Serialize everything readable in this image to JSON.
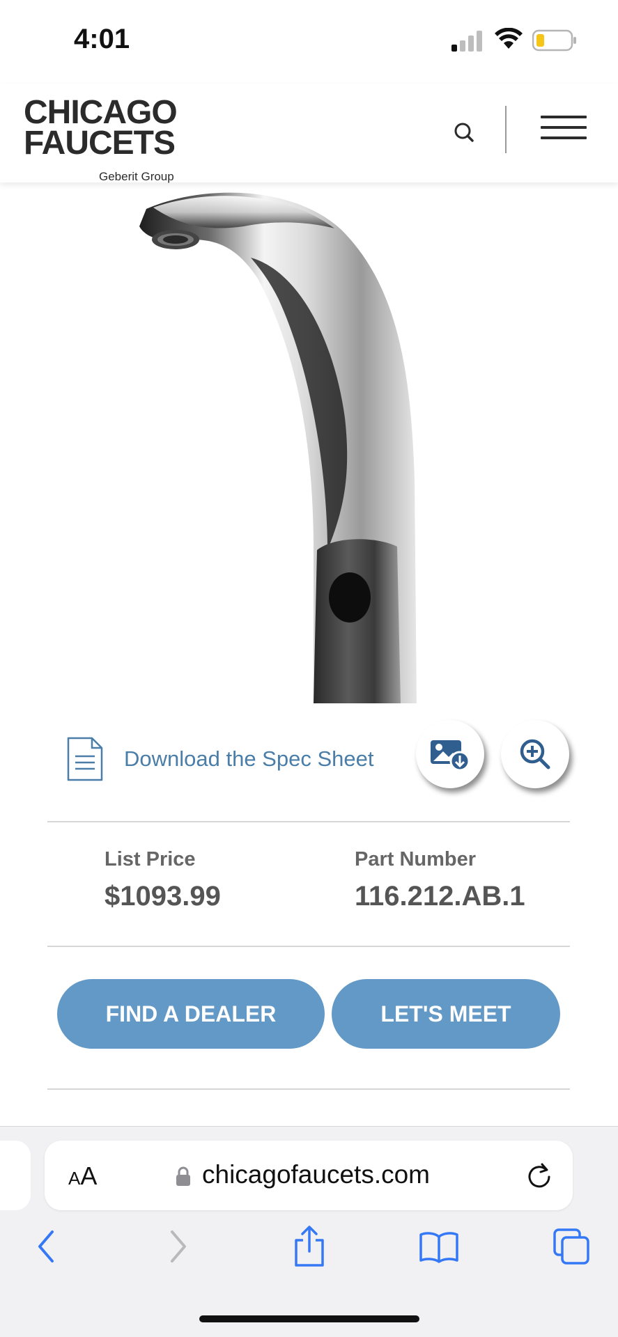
{
  "status_bar": {
    "time": "4:01",
    "signal_icon": "cellular-signal-icon",
    "wifi_icon": "wifi-icon",
    "battery_icon": "battery-low-icon",
    "battery_level": 0.2
  },
  "header": {
    "logo_line1": "CHICAGO",
    "logo_line2": "FAUCETS",
    "logo_sub": "Geberit Group",
    "search_icon": "search-icon",
    "menu_icon": "hamburger-menu-icon"
  },
  "product": {
    "image_alt": "faucet-product-image",
    "spec_sheet_label": "Download the Spec Sheet",
    "spec_icon": "document-icon",
    "image_download_icon": "image-download-icon",
    "zoom_icon": "zoom-in-icon",
    "list_price_label": "List Price",
    "list_price": "$1093.99",
    "part_number_label": "Part Number",
    "part_number": "116.212.AB.1"
  },
  "actions": {
    "find_dealer": "FIND A DEALER",
    "lets_meet": "LET'S MEET"
  },
  "browser": {
    "aa_big": "A",
    "aa_small": "A",
    "url": "chicagofaucets.com",
    "lock_icon": "lock-icon",
    "reload_icon": "reload-icon",
    "back_icon": "chevron-left-icon",
    "forward_icon": "chevron-right-icon",
    "share_icon": "share-icon",
    "bookmarks_icon": "book-icon",
    "tabs_icon": "tabs-icon"
  },
  "colors": {
    "accent": "#6399c6",
    "link": "#4a7ea8",
    "ios_blue": "#3478f6"
  }
}
